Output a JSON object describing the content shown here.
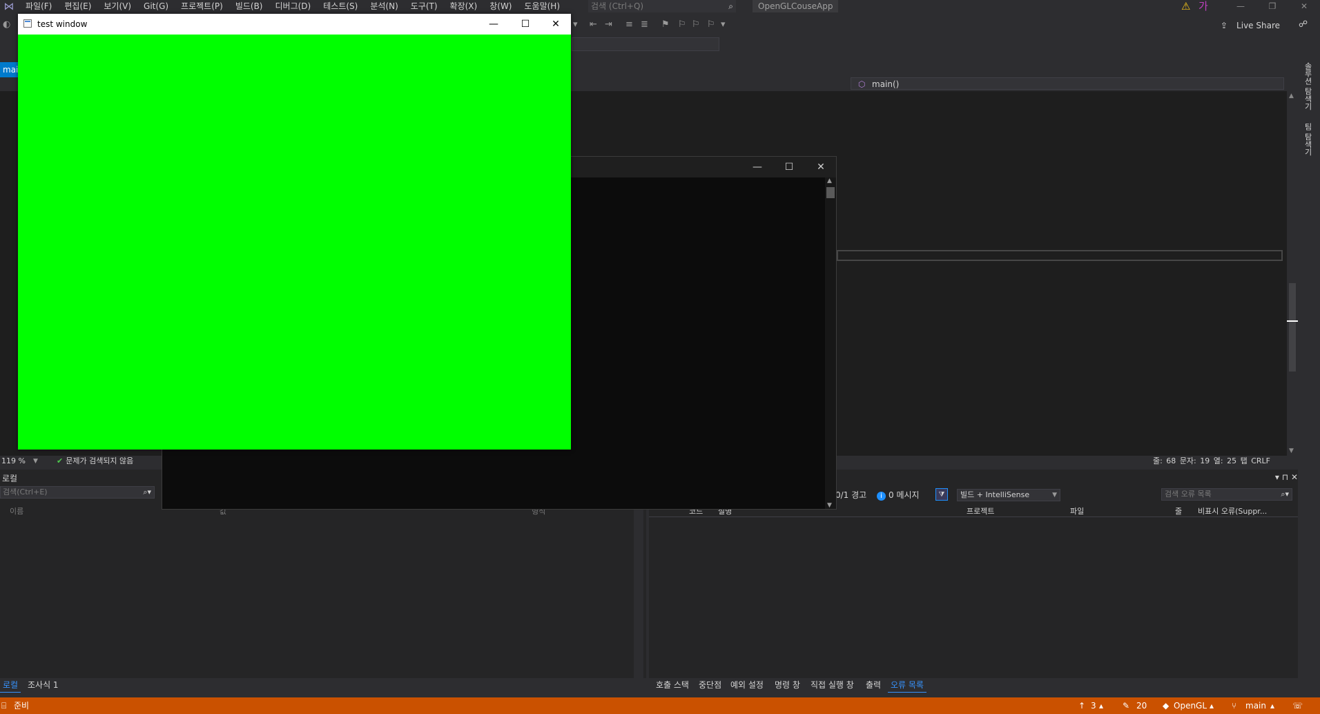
{
  "menubar": {
    "items": [
      "파일(F)",
      "편집(E)",
      "보기(V)",
      "Git(G)",
      "프로젝트(P)",
      "빌드(B)",
      "디버그(D)",
      "테스트(S)",
      "분석(N)",
      "도구(T)",
      "확장(X)",
      "창(W)",
      "도움말(H)"
    ],
    "search_placeholder": "검색 (Ctrl+Q)",
    "solution_name": "OpenGLCouseApp",
    "ime_indicator": "가"
  },
  "toolbar": {
    "live_share": "Live Share"
  },
  "editor": {
    "tab_label": "mai",
    "scope_function": "main()",
    "zoom": "119 %",
    "issues": "문제가 검색되지 않음",
    "line": "줄: 68",
    "char": "문자: 19",
    "col": "열: 25",
    "tab_mode": "탭",
    "eol": "CRLF"
  },
  "right_strip": {
    "solution_explorer": "솔루션 탐색기",
    "team_explorer": "팀 탐색기"
  },
  "locals_panel": {
    "title": "로컬",
    "search_placeholder": "검색(Ctrl+E)",
    "col_name": "이름",
    "col_value": "값",
    "col_type": "형식"
  },
  "error_panel": {
    "warnings": "0/1 경고",
    "messages": "0 메시지",
    "build_filter": "빌드 + IntelliSense",
    "search_placeholder": "검색 오류 목록",
    "columns": [
      "코드",
      "설명",
      "프로젝트",
      "파일",
      "줄",
      "비표시 오류(Suppr..."
    ]
  },
  "bottom_tabs_left": [
    "로컬",
    "조사식 1"
  ],
  "bottom_tabs_right": [
    "호출 스택",
    "중단점",
    "예외 설정",
    "명령 창",
    "직접 실행 창",
    "출력",
    "오류 목록"
  ],
  "statusbar": {
    "ready": "준비",
    "up_count": "3",
    "pencil_count": "20",
    "repo": "OpenGL",
    "branch": "main"
  },
  "test_window": {
    "title": "test window",
    "canvas_color": "#00ff00"
  },
  "colors": {
    "accent": "#007acc",
    "status_bar": "#ca5100",
    "background": "#2d2d30"
  }
}
